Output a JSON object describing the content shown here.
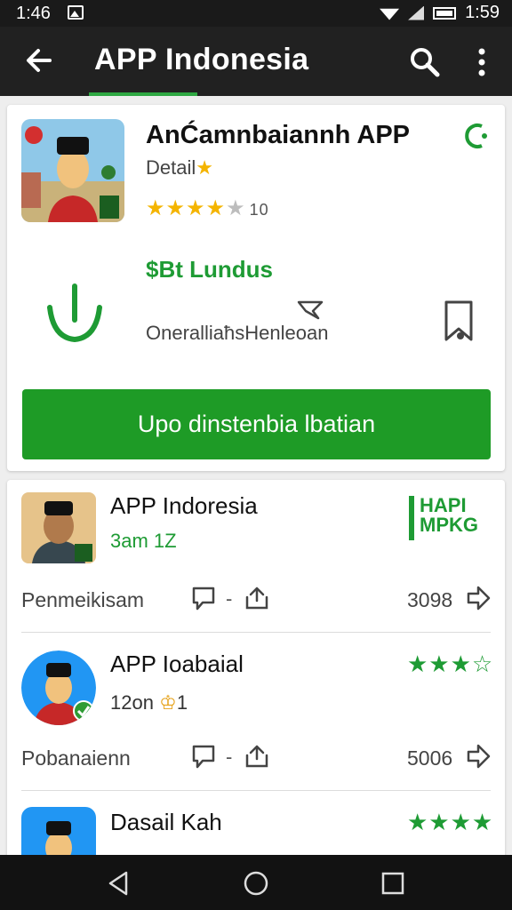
{
  "statusbar": {
    "time_left": "1:46",
    "time_right": "1:59"
  },
  "appbar": {
    "title": "APP Indonesia"
  },
  "app": {
    "name": "AnĆamnbaiannh APP",
    "detail": "Detail",
    "detail_star": "★",
    "rating_count": "10",
    "developer": "$Bt Lundus",
    "overall_label": "OneralliaħsHenleoan",
    "install_label": "Upo dinstenbia lbatian"
  },
  "list": [
    {
      "title": "APP Indoresia",
      "subtitle": "3am 1Z",
      "label": "Penmeikisam",
      "count": "3098",
      "badge_line1": "HAPI",
      "badge_line2": "MPKG"
    },
    {
      "title": "APP Ioabaial",
      "subtitle": "12on",
      "crown": "♔",
      "crown_suffix": "1",
      "label": "Pobanaienn",
      "count": "5006",
      "stars": "★★★☆"
    },
    {
      "title": "Dasail Kah",
      "stars": "★★★★"
    }
  ],
  "colors": {
    "accent": "#1e9b26",
    "appbar": "#212121",
    "star": "#f4b400"
  }
}
